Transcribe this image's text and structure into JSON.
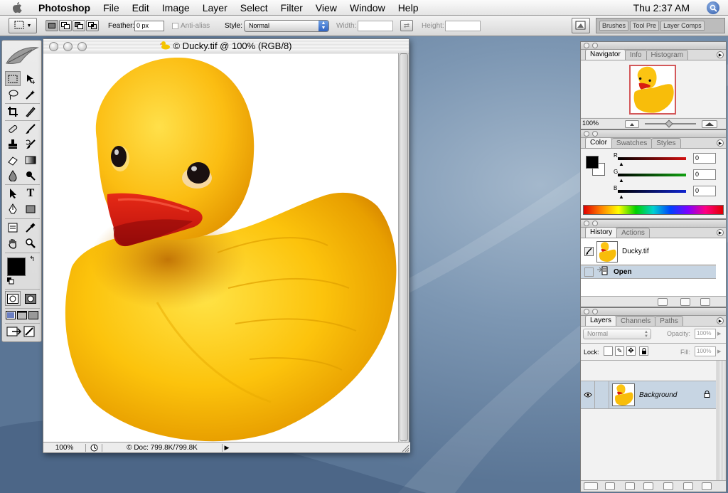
{
  "menubar": {
    "app": "Photoshop",
    "items": [
      "File",
      "Edit",
      "Image",
      "Layer",
      "Select",
      "Filter",
      "View",
      "Window",
      "Help"
    ],
    "clock": "Thu 2:37 AM"
  },
  "options": {
    "feather_label": "Feather:",
    "feather_value": "0 px",
    "antialias_label": "Anti-alias",
    "style_label": "Style:",
    "style_value": "Normal",
    "width_label": "Width:",
    "height_label": "Height:",
    "well_tabs": [
      "Brushes",
      "Tool Pre",
      "Layer Comps"
    ]
  },
  "document": {
    "title": "© Ducky.tif @ 100% (RGB/8)",
    "zoom": "100%",
    "doc_info": "© Doc: 799.8K/799.8K"
  },
  "navigator": {
    "tabs": [
      "Navigator",
      "Info",
      "Histogram"
    ],
    "zoom": "100%"
  },
  "color": {
    "tabs": [
      "Color",
      "Swatches",
      "Styles"
    ],
    "channels": [
      {
        "label": "R",
        "value": "0",
        "color": "#d21010"
      },
      {
        "label": "G",
        "value": "0",
        "color": "#10a010"
      },
      {
        "label": "B",
        "value": "0",
        "color": "#1024d0"
      }
    ]
  },
  "history": {
    "tabs": [
      "History",
      "Actions"
    ],
    "snapshot": "Ducky.tif",
    "state": "Open"
  },
  "layers": {
    "tabs": [
      "Layers",
      "Channels",
      "Paths"
    ],
    "blend_mode": "Normal",
    "opacity_label": "Opacity:",
    "opacity_value": "100%",
    "lock_label": "Lock:",
    "fill_label": "Fill:",
    "fill_value": "100%",
    "layer_name": "Background"
  }
}
